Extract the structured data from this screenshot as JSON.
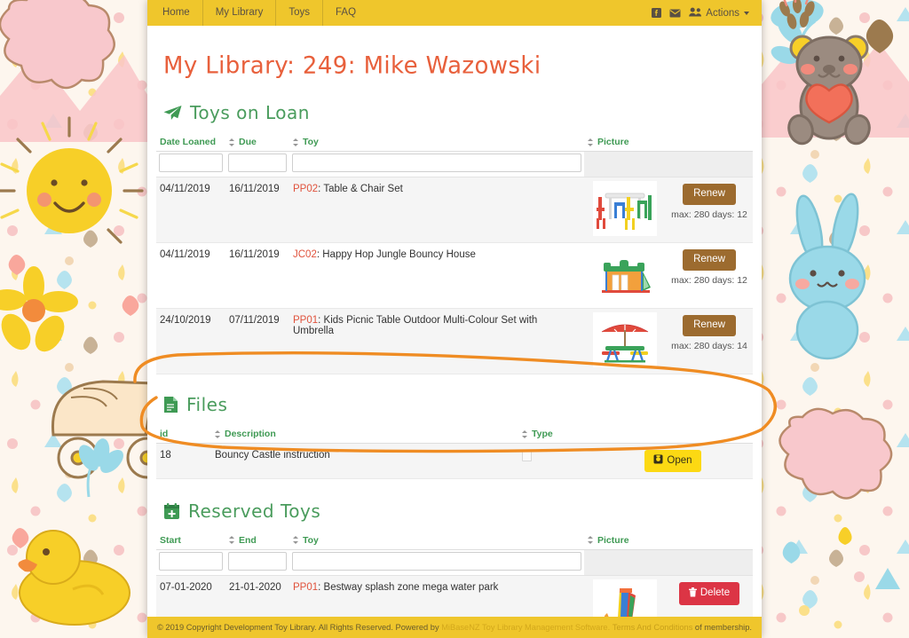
{
  "nav": {
    "links": [
      {
        "label": "Home",
        "name": "nav-link-home"
      },
      {
        "label": "My Library",
        "name": "nav-link-my-library"
      },
      {
        "label": "Toys",
        "name": "nav-link-toys"
      },
      {
        "label": "FAQ",
        "name": "nav-link-faq"
      }
    ],
    "facebook_icon": "facebook-icon",
    "mail_icon": "envelope-icon",
    "actions_label": "Actions",
    "actions_icon": "users-icon"
  },
  "header": {
    "page_title": "My Library: 249: Mike Wazowski"
  },
  "colors": {
    "navbar": "#efc62c",
    "title": "#e8603c",
    "section_heading": "#4a9c5d",
    "table_header": "#3f9a54",
    "toy_code": "#e0523c",
    "renew_button": "#9c6b2f",
    "open_button": "#fcd913",
    "delete_button": "#dc3545",
    "annotation": "#ef8c23"
  },
  "toys_on_loan": {
    "icon": "paper-plane-icon",
    "title": "Toys on Loan",
    "columns": [
      {
        "label": "Date Loaned",
        "sortable": true
      },
      {
        "label": "Due",
        "sortable": true
      },
      {
        "label": "Toy",
        "sortable": true
      },
      {
        "label": "Picture",
        "sortable": false
      },
      {
        "label": "",
        "sortable": false
      }
    ],
    "filters": [
      "",
      "",
      ""
    ],
    "rows": [
      {
        "date_loaned": "04/11/2019",
        "due": "16/11/2019",
        "toy_code": "PP02",
        "toy_name": "Table & Chair Set",
        "picture": "table-and-chair-set-thumbnail",
        "action_label": "Renew",
        "action_note": "max: 280 days: 12"
      },
      {
        "date_loaned": "04/11/2019",
        "due": "16/11/2019",
        "toy_code": "JC02",
        "toy_name": "Happy Hop Jungle Bouncy House",
        "picture": "bouncy-house-thumbnail",
        "action_label": "Renew",
        "action_note": "max: 280 days: 12"
      },
      {
        "date_loaned": "24/10/2019",
        "due": "07/11/2019",
        "toy_code": "PP01",
        "toy_name": "Kids Picnic Table Outdoor Multi-Colour Set with Umbrella",
        "picture": "picnic-table-umbrella-thumbnail",
        "action_label": "Renew",
        "action_note": "max: 280 days: 14"
      }
    ]
  },
  "files": {
    "icon": "file-document-icon",
    "title": "Files",
    "columns": [
      {
        "label": "id",
        "sortable": false
      },
      {
        "label": "Description",
        "sortable": true
      },
      {
        "label": "Type",
        "sortable": true
      },
      {
        "label": "",
        "sortable": false
      }
    ],
    "rows": [
      {
        "id": "18",
        "description": "Bouncy Castle instruction",
        "type": "",
        "action_label": "Open",
        "action_icon": "file-open-icon"
      }
    ]
  },
  "reserved_toys": {
    "icon": "calendar-plus-icon",
    "title": "Reserved Toys",
    "columns": [
      {
        "label": "Start",
        "sortable": true
      },
      {
        "label": "End",
        "sortable": true
      },
      {
        "label": "Toy",
        "sortable": true
      },
      {
        "label": "Picture",
        "sortable": false
      },
      {
        "label": "",
        "sortable": false
      }
    ],
    "filters": [
      "",
      "",
      ""
    ],
    "rows": [
      {
        "start": "07-01-2020",
        "end": "21-01-2020",
        "toy_code": "PP01",
        "toy_name": "Bestway splash zone mega water park",
        "picture": "water-park-thumbnail",
        "action_label": "Delete",
        "action_icon": "trash-icon"
      }
    ]
  },
  "footer": {
    "copyright_prefix": "© 2019 Copyright Development Toy Library. All Rights Reserved. Powered by",
    "powered_by": "MiBaseNZ Toy Library Management Software.",
    "terms_link": "Terms And Conditions",
    "terms_suffix": " of membership."
  },
  "annotation": {
    "type": "hand-drawn-oval-highlight",
    "target": "files-section",
    "color": "#ef8c23"
  }
}
